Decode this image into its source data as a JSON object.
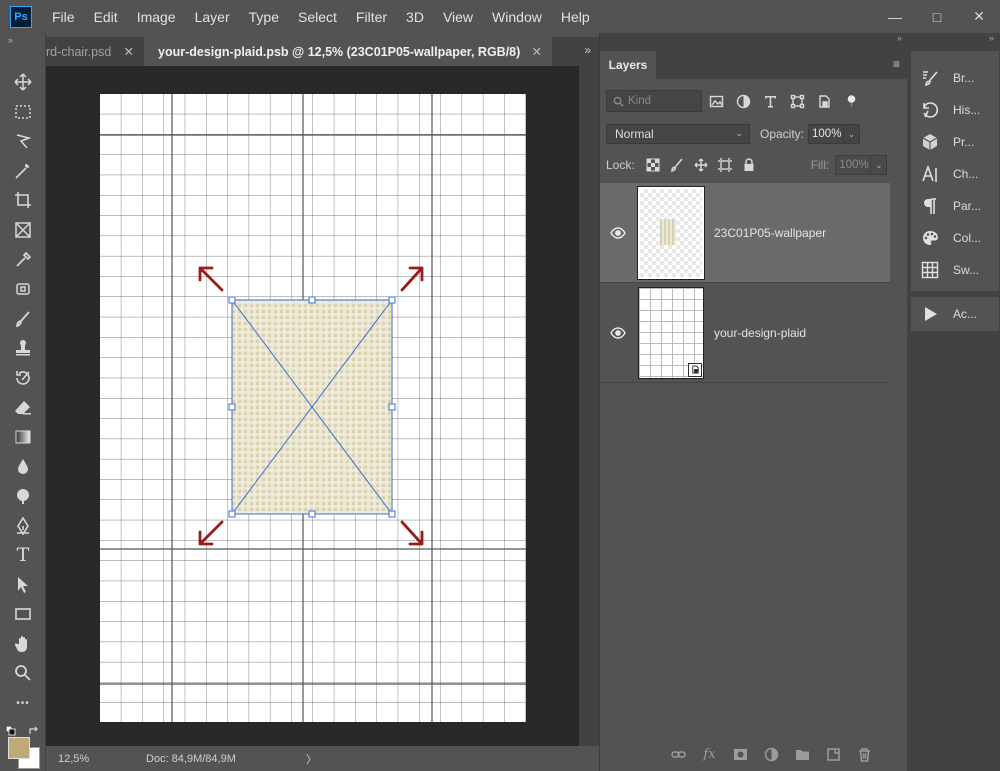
{
  "app": {
    "logo_text": "Ps",
    "menu": [
      "File",
      "Edit",
      "Image",
      "Layer",
      "Type",
      "Select",
      "Filter",
      "3D",
      "View",
      "Window",
      "Help"
    ],
    "window_controls": {
      "minimize": "—",
      "maximize": "□",
      "close": "✕"
    }
  },
  "tabs": [
    {
      "label": "rd-chair.psd",
      "close": "✕",
      "active": false
    },
    {
      "label": "your-design-plaid.psb @ 12,5% (23C01P05-wallpaper, RGB/8)",
      "close": "✕",
      "active": true
    }
  ],
  "tab_overflow": "»",
  "collapse_arrows": "»",
  "toolbar": {
    "tools": [
      "move-tool",
      "marquee-tool",
      "lasso-tool",
      "magic-wand-tool",
      "crop-tool",
      "frame-tool",
      "eyedropper-tool",
      "healing-brush-tool",
      "brush-tool",
      "clone-stamp-tool",
      "history-brush-tool",
      "eraser-tool",
      "gradient-tool",
      "blur-tool",
      "dodge-tool",
      "pen-tool",
      "type-tool",
      "path-selection-tool",
      "rectangle-tool",
      "hand-tool",
      "zoom-tool",
      "more-tools"
    ],
    "type_glyph": "T",
    "more_glyph": "•••",
    "foreground_color": "#c2a77a",
    "background_color": "#ffffff"
  },
  "status": {
    "zoom": "12,5%",
    "doc_size": "Doc: 84,9M/84,9M",
    "arrow": "〉"
  },
  "layers_panel": {
    "tab_label": "Layers",
    "menu_glyph": "≡",
    "kind_placeholder": "Kind",
    "blend_mode": "Normal",
    "opacity_label": "Opacity:",
    "opacity_value": "100%",
    "lock_label": "Lock:",
    "fill_label": "Fill:",
    "fill_value": "100%",
    "layers": [
      {
        "name": "23C01P05-wallpaper",
        "visible": true,
        "selected": true
      },
      {
        "name": "your-design-plaid",
        "visible": true,
        "selected": false
      }
    ],
    "bottom_actions": [
      "link-layers",
      "fx",
      "add-mask",
      "adjustment-layer",
      "new-group",
      "new-layer",
      "delete-layer"
    ],
    "fx_glyph": "fx"
  },
  "right_dock": {
    "items": [
      {
        "label": "Br...",
        "icon": "brushes-icon"
      },
      {
        "label": "His...",
        "icon": "history-icon"
      },
      {
        "label": "Pr...",
        "icon": "properties-icon"
      },
      {
        "label": "Ch...",
        "icon": "character-icon"
      },
      {
        "label": "Par...",
        "icon": "paragraph-icon"
      },
      {
        "label": "Col...",
        "icon": "color-icon"
      },
      {
        "label": "Sw...",
        "icon": "swatches-icon"
      }
    ],
    "actions_item": {
      "label": "Ac...",
      "icon": "actions-icon"
    }
  },
  "colors": {
    "accent": "#31a8ff",
    "transform_handles": "#3b6fd6",
    "arrow_annotation": "#9b1b1b",
    "wallpaper_tint": "#e9e3cc"
  }
}
